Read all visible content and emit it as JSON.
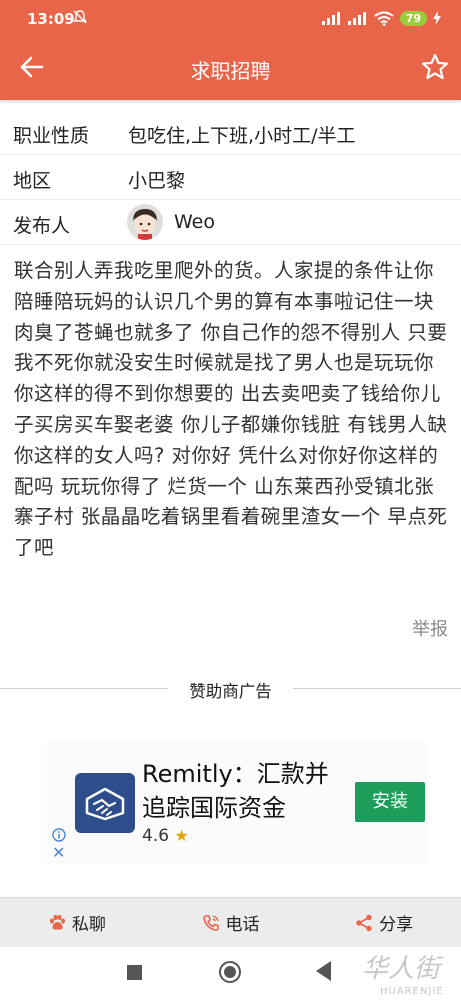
{
  "status_bar": {
    "time": "13:09",
    "battery": "79",
    "icons": [
      "mute-icon",
      "signal-icon",
      "signal-icon",
      "wifi-icon",
      "battery-icon",
      "charging-icon"
    ]
  },
  "app_bar": {
    "title": "求职招聘",
    "back_icon": "arrow-left-icon",
    "favorite_icon": "star-outline-icon"
  },
  "details": {
    "job_type_label": "职业性质",
    "job_type_value": "包吃住,上下班,小时工/半工",
    "location_label": "地区",
    "location_value": "小巴黎",
    "poster_label": "发布人",
    "poster_name": "Weo"
  },
  "description": "联合别人弄我吃里爬外的货。人家提的条件让你陪睡陪玩妈的认识几个男的算有本事啦记住一块肉臭了苍蝇也就多了 你自己作的怨不得别人 只要我不死你就没安生时候就是找了男人也是玩玩你你这样的得不到你想要的 出去卖吧卖了钱给你儿子买房买车娶老婆 你儿子都嫌你钱脏 有钱男人缺你这样的女人吗? 对你好 凭什么对你好你这样的配吗 玩玩你得了 烂货一个 山东莱西孙受镇北张寨子村 张晶晶吃着锅里看着碗里渣女一个 早点死了吧",
  "report_label": "举报",
  "sponsor": {
    "label": "赞助商广告",
    "ad_title": "Remitly：汇款并追踪国际资金",
    "rating": "4.6",
    "install_label": "安装",
    "close_mark": "✕"
  },
  "actions": {
    "chat_label": "私聊",
    "phone_label": "电话",
    "share_label": "分享"
  },
  "watermark": {
    "line1": "华人街",
    "line2": "HUARENJIE"
  },
  "colors": {
    "primary": "#e8654a",
    "install_green": "#1c9e5a",
    "ad_icon_blue": "#2e4d8c"
  }
}
